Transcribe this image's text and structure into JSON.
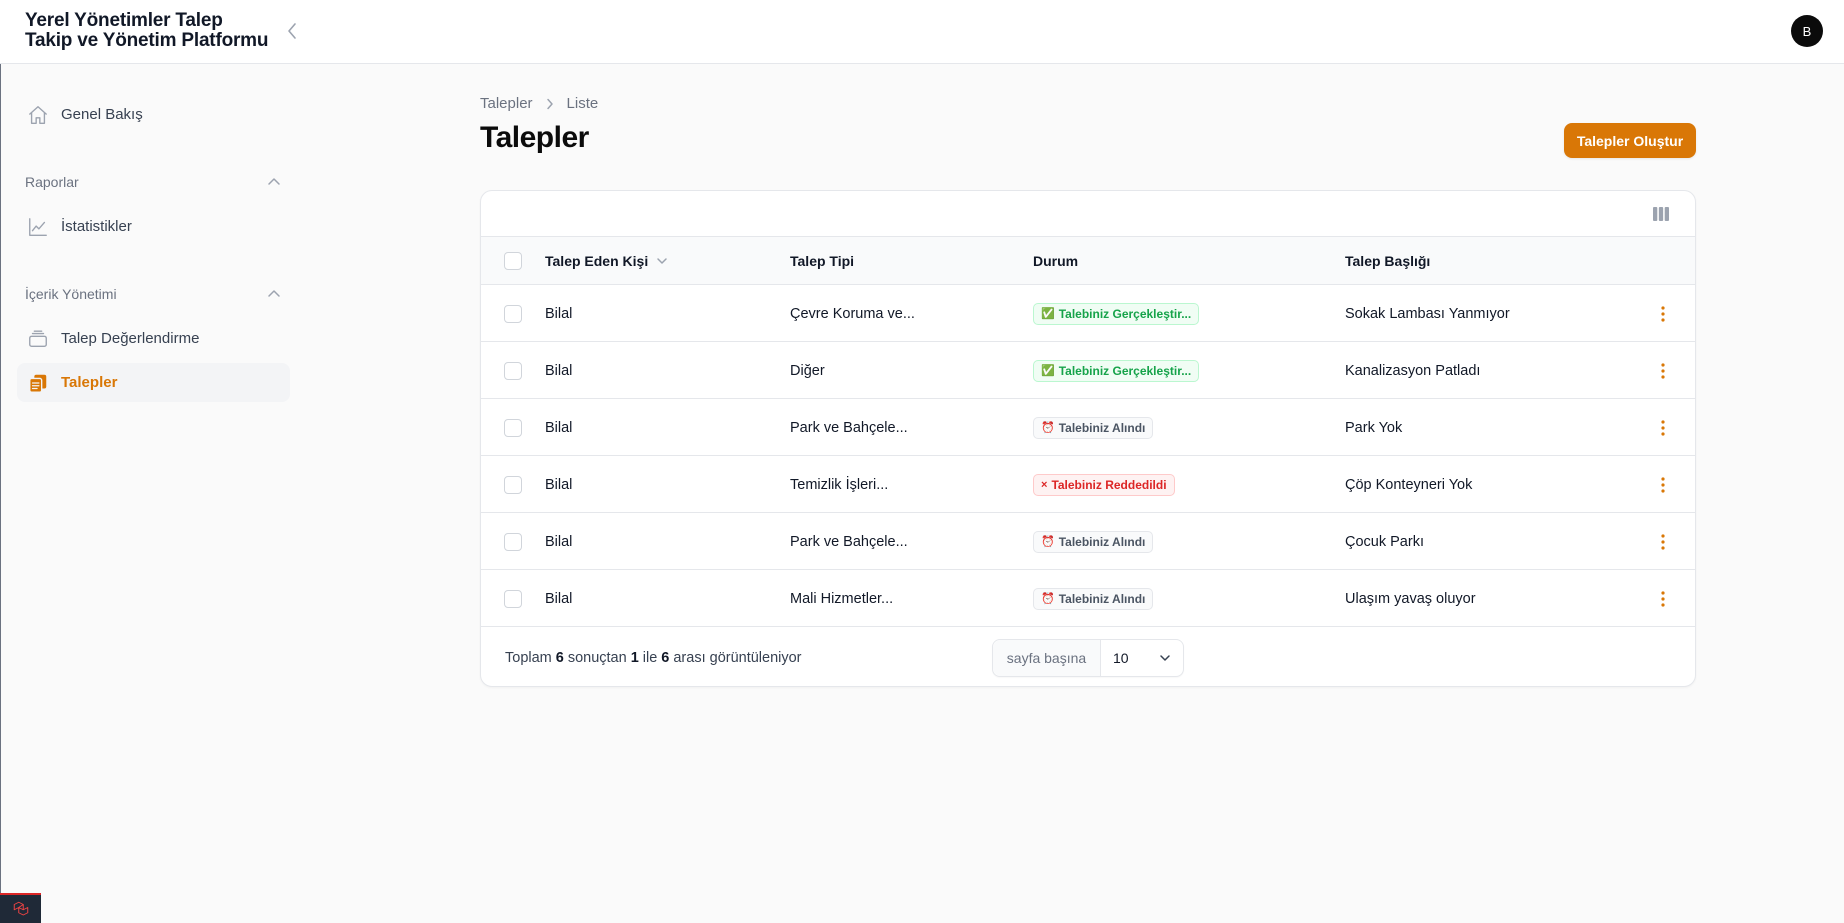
{
  "app": {
    "title_line1": "Yerel Yönetimler Talep",
    "title_line2": "Takip ve Yönetim Platformu",
    "avatar_initial": "B"
  },
  "sidebar": {
    "dashboard": {
      "label": "Genel Bakış",
      "icon": "home-icon"
    },
    "groups": [
      {
        "label": "Raporlar",
        "items": [
          {
            "label": "İstatistikler",
            "icon": "chart-line-icon"
          }
        ]
      },
      {
        "label": "İçerik Yönetimi",
        "items": [
          {
            "label": "Talep Değerlendirme",
            "icon": "inbox-stack-icon"
          },
          {
            "label": "Talepler",
            "icon": "clipboard-document-icon",
            "active": true
          }
        ]
      }
    ]
  },
  "breadcrumb": {
    "items": [
      "Talepler",
      "Liste"
    ]
  },
  "page": {
    "title": "Talepler",
    "create_label": "Talepler Oluştur"
  },
  "table": {
    "columns": [
      "Talep Eden Kişi",
      "Talep Tipi",
      "Durum",
      "Talep Başlığı"
    ],
    "rows": [
      {
        "person": "Bilal",
        "type": "Çevre Koruma ve...",
        "status": "Talebiniz Gerçekleştir...",
        "status_icon": "✅",
        "status_kind": "success",
        "title": "Sokak Lambası Yanmıyor"
      },
      {
        "person": "Bilal",
        "type": "Diğer",
        "status": "Talebiniz Gerçekleştir...",
        "status_icon": "✅",
        "status_kind": "success",
        "title": "Kanalizasyon Patladı"
      },
      {
        "person": "Bilal",
        "type": "Park ve Bahçele...",
        "status": "Talebiniz Alındı",
        "status_icon": "⏰",
        "status_kind": "gray",
        "title": "Park Yok"
      },
      {
        "person": "Bilal",
        "type": "Temizlik İşleri...",
        "status": "Talebiniz Reddedildi",
        "status_icon": "×",
        "status_kind": "danger",
        "title": "Çöp Konteyneri Yok"
      },
      {
        "person": "Bilal",
        "type": "Park ve Bahçele...",
        "status": "Talebiniz Alındı",
        "status_icon": "⏰",
        "status_kind": "gray",
        "title": "Çocuk Parkı"
      },
      {
        "person": "Bilal",
        "type": "Mali Hizmetler...",
        "status": "Talebiniz Alındı",
        "status_icon": "⏰",
        "status_kind": "gray",
        "title": "Ulaşım yavaş oluyor"
      }
    ],
    "footer": {
      "summary_prefix": "Toplam",
      "total": "6",
      "summary_mid1": "sonuçtan",
      "from": "1",
      "summary_mid2": "ile",
      "to": "6",
      "summary_suffix": "arası görüntüleniyor",
      "per_page_label": "sayfa başına",
      "per_page_value": "10"
    }
  },
  "colors": {
    "accent": "#d97706",
    "success": "#16a34a",
    "danger": "#dc2626"
  }
}
